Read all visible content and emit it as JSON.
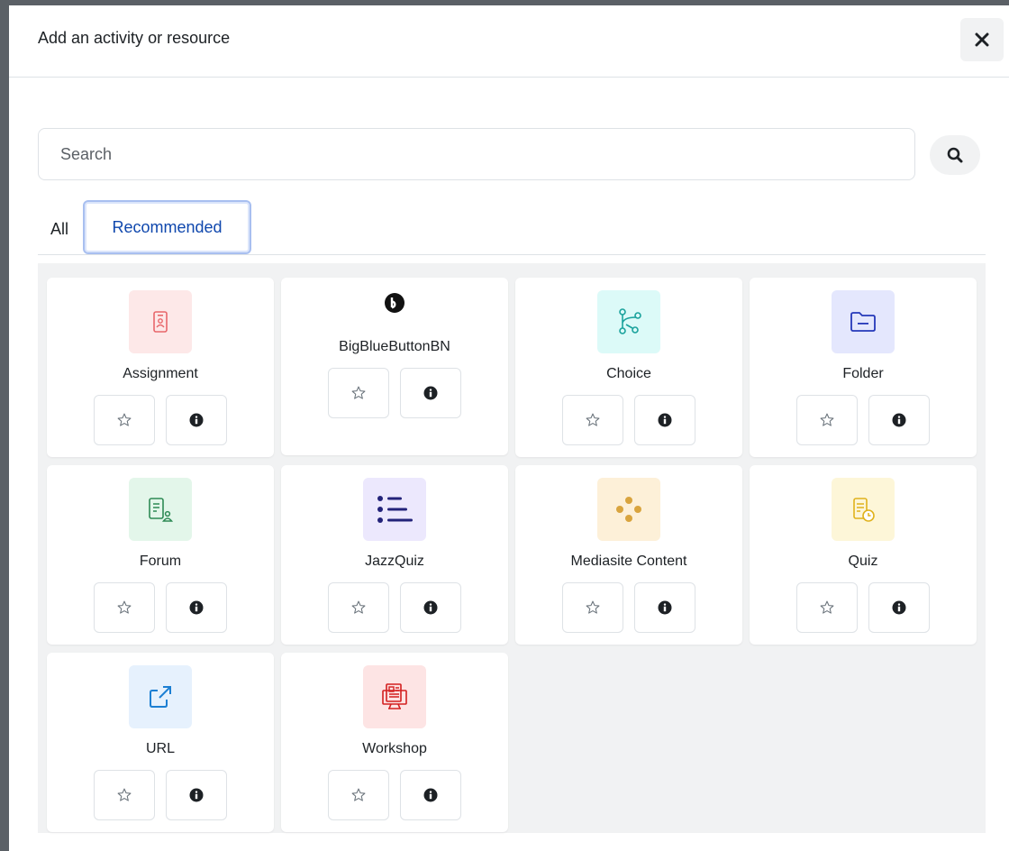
{
  "modal": {
    "title": "Add an activity or resource"
  },
  "search": {
    "placeholder": "Search"
  },
  "tabs": [
    {
      "label": "All",
      "active": false
    },
    {
      "label": "Recommended",
      "active": true
    }
  ],
  "activities": [
    {
      "name": "Assignment",
      "icon": "assignment-icon",
      "tile_color": "#fde8e8",
      "icon_color": "#e8676b"
    },
    {
      "name": "BigBlueButtonBN",
      "icon": "bigbluebutton-icon",
      "tile_color": "",
      "icon_color": "#111111"
    },
    {
      "name": "Choice",
      "icon": "choice-icon",
      "tile_color": "#dcfaf8",
      "icon_color": "#1aa29c"
    },
    {
      "name": "Folder",
      "icon": "folder-icon",
      "tile_color": "#e4e7fd",
      "icon_color": "#2538b9"
    },
    {
      "name": "Forum",
      "icon": "forum-icon",
      "tile_color": "#e3f6ea",
      "icon_color": "#2e8a55"
    },
    {
      "name": "JazzQuiz",
      "icon": "jazzquiz-icon",
      "tile_color": "#ece8fd",
      "icon_color": "#23237a"
    },
    {
      "name": "Mediasite Content",
      "icon": "mediasite-icon",
      "tile_color": "#fdf0d8",
      "icon_color": "#d9a43e"
    },
    {
      "name": "Quiz",
      "icon": "quiz-icon",
      "tile_color": "#fdf6d8",
      "icon_color": "#e0b21c"
    },
    {
      "name": "URL",
      "icon": "url-icon",
      "tile_color": "#e6f1fd",
      "icon_color": "#1c7fd3"
    },
    {
      "name": "Workshop",
      "icon": "workshop-icon",
      "tile_color": "#fde4e4",
      "icon_color": "#d32020"
    }
  ]
}
